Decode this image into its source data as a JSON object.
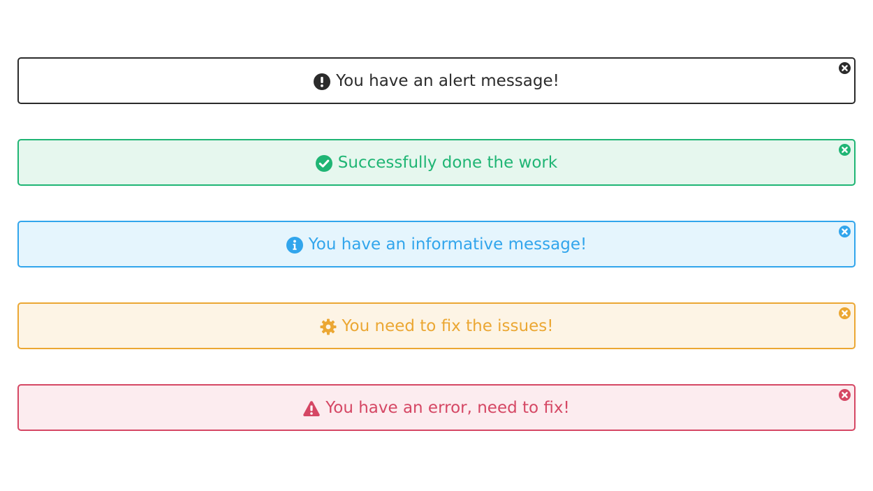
{
  "alerts": [
    {
      "variant": "default",
      "icon": "exclamation-circle-icon",
      "message": "You have an alert message!",
      "close_icon": "close-circle-icon",
      "color": "#2b2b2b",
      "background": "#ffffff"
    },
    {
      "variant": "success",
      "icon": "check-circle-icon",
      "message": "Successfully done the work",
      "close_icon": "close-circle-icon",
      "color": "#1fb574",
      "background": "#e6f7ee"
    },
    {
      "variant": "info",
      "icon": "info-circle-icon",
      "message": "You have an informative message!",
      "close_icon": "close-circle-icon",
      "color": "#31a5ec",
      "background": "#e5f5fd"
    },
    {
      "variant": "warning",
      "icon": "gear-icon",
      "message": "You need to fix the issues!",
      "close_icon": "close-circle-icon",
      "color": "#eba733",
      "background": "#fdf4e5"
    },
    {
      "variant": "danger",
      "icon": "warning-triangle-icon",
      "message": "You have an error, need to fix!",
      "close_icon": "close-circle-icon",
      "color": "#d54764",
      "background": "#fcecef"
    }
  ]
}
